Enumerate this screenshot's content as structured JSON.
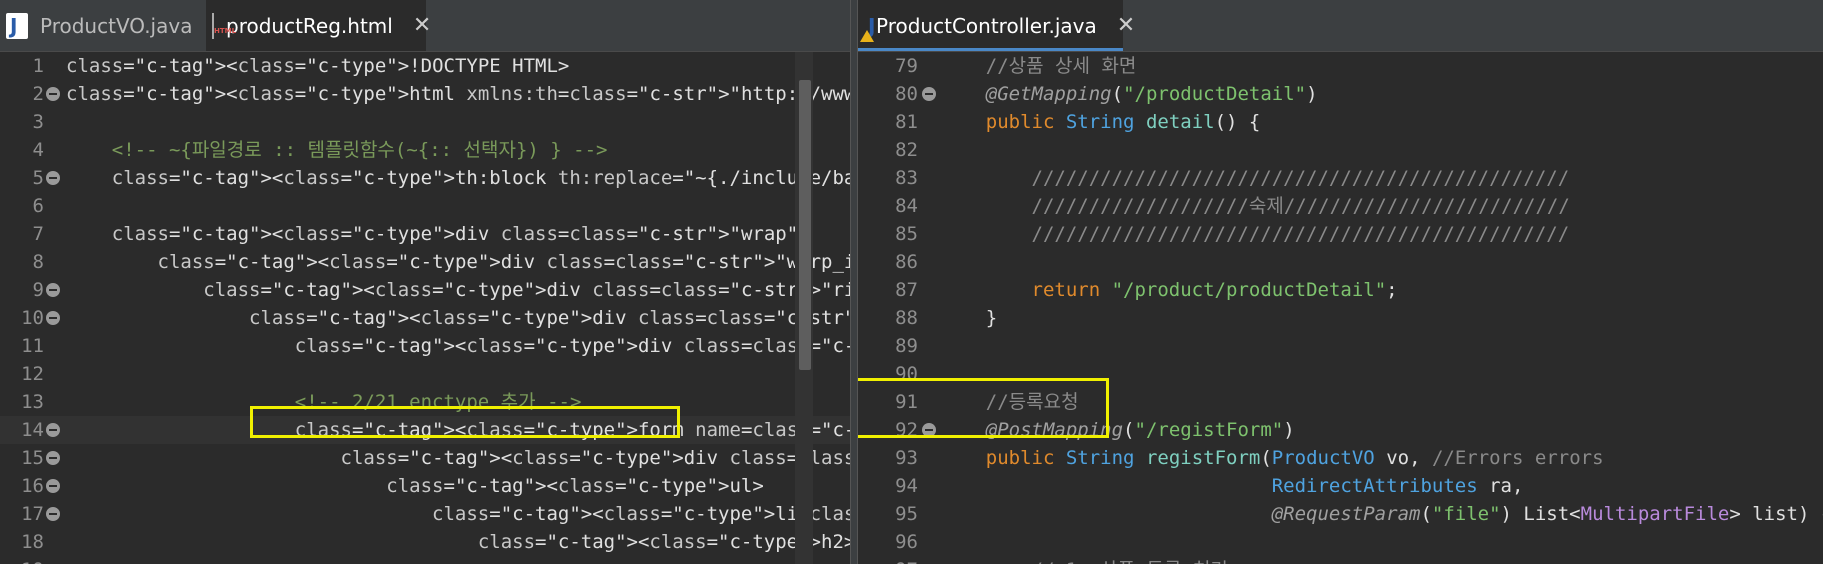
{
  "left": {
    "tabs": [
      {
        "label": "ProductVO.java",
        "icon": "java-file-icon",
        "active": false
      },
      {
        "label": "productReg.html",
        "icon": "html-file-icon",
        "active": true
      }
    ],
    "lines": [
      {
        "n": "1",
        "text": "<!DOCTYPE HTML>"
      },
      {
        "n": "2",
        "text": "<html xmlns:th=\"http://www.thymeleaf.org\">"
      },
      {
        "n": "3",
        "text": ""
      },
      {
        "n": "4",
        "text": "    <!-- ~{파일경로 :: 템플릿함수(~{:: 선택자}) } -->"
      },
      {
        "n": "5",
        "text": "    <th:block th:replace=\"~{./include/basicLayout :: layout( ~{::"
      },
      {
        "n": "6",
        "text": ""
      },
      {
        "n": "7",
        "text": "    <div class=\"wrap\">"
      },
      {
        "n": "8",
        "text": "        <div class=\"warp_inner\">"
      },
      {
        "n": "9",
        "text": "            <div class=\"right_content\">"
      },
      {
        "n": "10",
        "text": "                <div class=\"midiaq\">"
      },
      {
        "n": "11",
        "text": "                    <div class=\"page_title\">상품 관리 > 상품 등록"
      },
      {
        "n": "12",
        "text": ""
      },
      {
        "n": "13",
        "text": "                    <!-- 2/21 enctype 추가 -->"
      },
      {
        "n": "14",
        "text": "                    <form name=\"productForm\" action=\"registForm\""
      },
      {
        "n": "15",
        "text": "                        <div class=\"full_collum collum\">"
      },
      {
        "n": "16",
        "text": "                            <ul>"
      },
      {
        "n": "17",
        "text": "                                <li class=\"collum_tit\">"
      },
      {
        "n": "18",
        "text": "                                    <h2>게시글관리</h2>"
      },
      {
        "n": "19",
        "text": ""
      }
    ]
  },
  "right": {
    "tabs": [
      {
        "label": "ProductController.java",
        "icon": "java-file-warning-icon",
        "active": true
      }
    ],
    "lines": [
      {
        "n": "79",
        "text": "    //상품 상세 화면"
      },
      {
        "n": "80",
        "text": "    @GetMapping(\"/productDetail\")"
      },
      {
        "n": "81",
        "text": "    public String detail() {"
      },
      {
        "n": "82",
        "text": ""
      },
      {
        "n": "83",
        "text": "        ///////////////////////////////////////////////"
      },
      {
        "n": "84",
        "text": "        ///////////////////숙제/////////////////////////"
      },
      {
        "n": "85",
        "text": "        ///////////////////////////////////////////////"
      },
      {
        "n": "86",
        "text": ""
      },
      {
        "n": "87",
        "text": "        return \"/product/productDetail\";"
      },
      {
        "n": "88",
        "text": "    }"
      },
      {
        "n": "89",
        "text": ""
      },
      {
        "n": "90",
        "text": ""
      },
      {
        "n": "91",
        "text": "    //등록요청"
      },
      {
        "n": "92",
        "text": "    @PostMapping(\"/registForm\")"
      },
      {
        "n": "93",
        "text": "    public String registForm(ProductVO vo, //Errors errors"
      },
      {
        "n": "94",
        "text": "                             RedirectAttributes ra,"
      },
      {
        "n": "95",
        "text": "                             @RequestParam(\"file\") List<MultipartFile> list) {"
      },
      {
        "n": "96",
        "text": ""
      },
      {
        "n": "97",
        "text": "        // 1. 상품 등록 처리"
      }
    ]
  },
  "colors": {
    "editor_bg": "#2b2b2b",
    "highlight_box": "#f0f000",
    "keyword": "#e08a2c",
    "string": "#7ec26e",
    "type": "#4fa3e0"
  }
}
